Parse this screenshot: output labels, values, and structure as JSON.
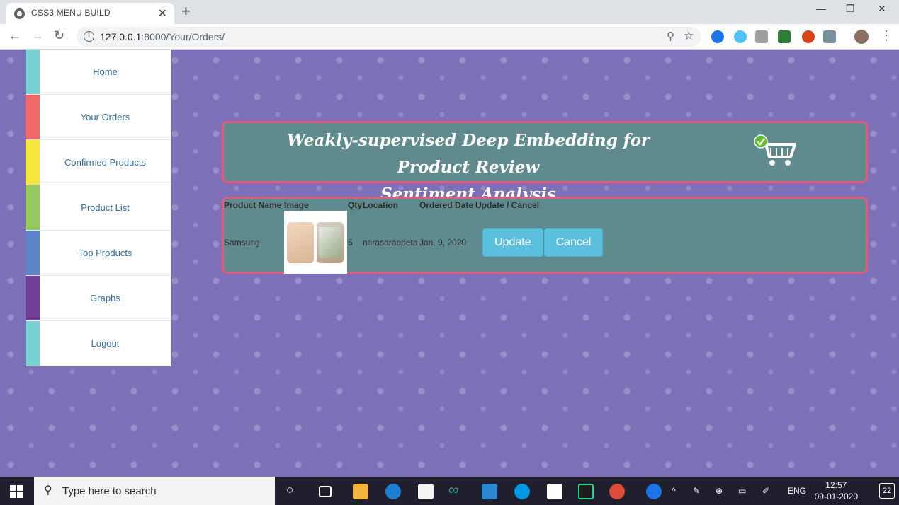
{
  "browser": {
    "tab_title": "CSS3 MENU BUILD",
    "url_host": "127.0.0.1",
    "url_path": ":8000/Your/Orders/"
  },
  "sidebar": {
    "items": [
      {
        "label": "Home",
        "color": "#77d3d4"
      },
      {
        "label": "Your Orders",
        "color": "#f06767"
      },
      {
        "label": "Confirmed Products",
        "color": "#f4e63c"
      },
      {
        "label": "Product List",
        "color": "#96c95d"
      },
      {
        "label": "Top Products",
        "color": "#5c82c8"
      },
      {
        "label": "Graphs",
        "color": "#6e3e99"
      },
      {
        "label": "Logout",
        "color": "#77d3d4"
      }
    ]
  },
  "banner": {
    "line1": "Weakly-supervised Deep Embedding for Product Review",
    "line2": "Sentiment Analysis",
    "icon": "cart-check-icon"
  },
  "orders": {
    "headers": [
      "Product Name",
      "Image",
      "Qty",
      "Location",
      "Ordered Date",
      "Update / Cancel"
    ],
    "rows": [
      {
        "name": "Samsung",
        "qty": "5",
        "location": "narasaraopeta",
        "date": "Jan. 9, 2020",
        "update_label": "Update",
        "cancel_label": "Cancel"
      }
    ]
  },
  "taskbar": {
    "search_placeholder": "Type here to search",
    "lang": "ENG",
    "time": "12:57",
    "date": "09-01-2020",
    "notifications": "22"
  },
  "colors": {
    "page_bg": "#7d70b8",
    "panel_bg": "#5f8b8f",
    "panel_border": "#e05c78",
    "button": "#5bc0de"
  }
}
